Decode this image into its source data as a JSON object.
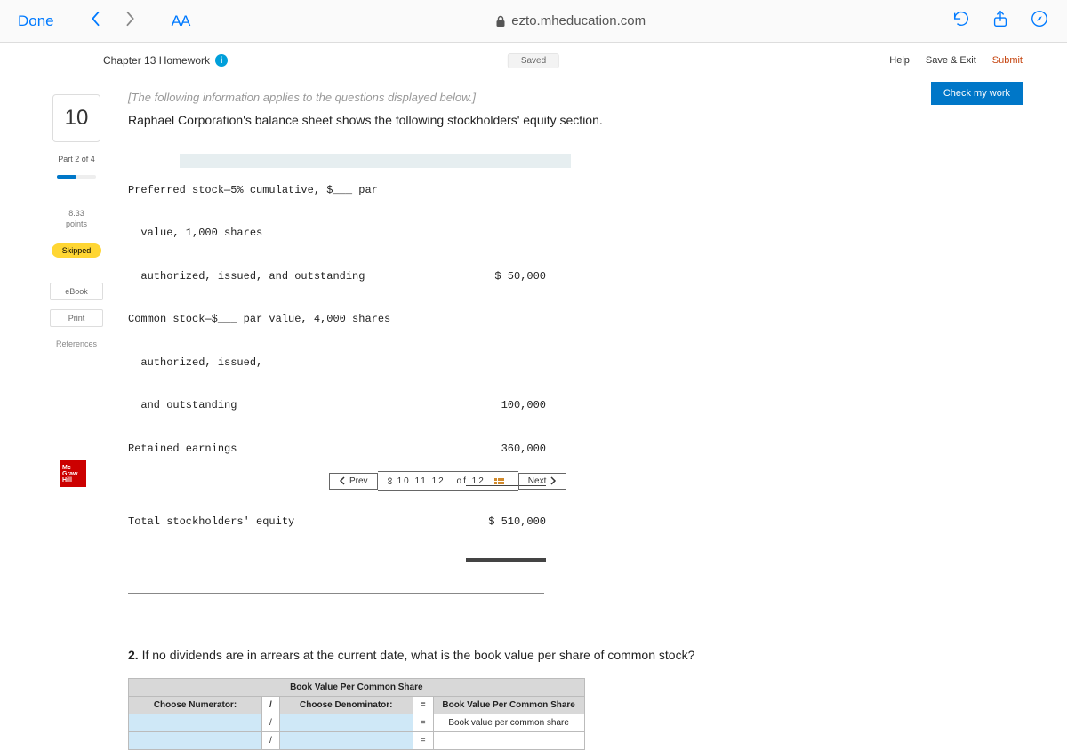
{
  "browser": {
    "done": "Done",
    "aa": "AA",
    "url": "ezto.mheducation.com"
  },
  "header": {
    "title": "Chapter 13 Homework",
    "saved": "Saved",
    "help": "Help",
    "save_exit": "Save & Exit",
    "submit": "Submit",
    "check": "Check my work"
  },
  "sidebar": {
    "qnum": "10",
    "part": "Part 2 of 4",
    "points_val": "8.33",
    "points_lbl": "points",
    "skipped": "Skipped",
    "ebook": "eBook",
    "print": "Print",
    "references": "References"
  },
  "body": {
    "note": "[The following information applies to the questions displayed below.]",
    "intro": "Raphael Corporation's balance sheet shows the following stockholders' equity section.",
    "rows": {
      "pref1": "Preferred stock—5% cumulative, $___ par",
      "pref2": "  value, 1,000 shares",
      "pref3": "  authorized, issued, and outstanding",
      "pref_v": "$ 50,000",
      "com1": "Common stock—$___ par value, 4,000 shares",
      "com2": "  authorized, issued,",
      "com3": "  and outstanding",
      "com_v": "100,000",
      "re": "Retained earnings",
      "re_v": "360,000",
      "tot": "Total stockholders' equity",
      "tot_v": "$ 510,000"
    },
    "q2_num": "2.",
    "q2_text": " If no dividends are in arrears at the current date, what is the book value per share of common stock?"
  },
  "table": {
    "group_header": "Book Value Per Common Share",
    "num": "Choose Numerator:",
    "den": "Choose Denominator:",
    "res1": "Book Value Per Common Share",
    "res2": "Book value per common share",
    "slash": "/",
    "eq": "="
  },
  "nav": {
    "prev": "Prev",
    "pages": "10   11   12",
    "of": "of 12",
    "next": "Next"
  },
  "logo": {
    "l1": "Mc",
    "l2": "Graw",
    "l3": "Hill"
  }
}
